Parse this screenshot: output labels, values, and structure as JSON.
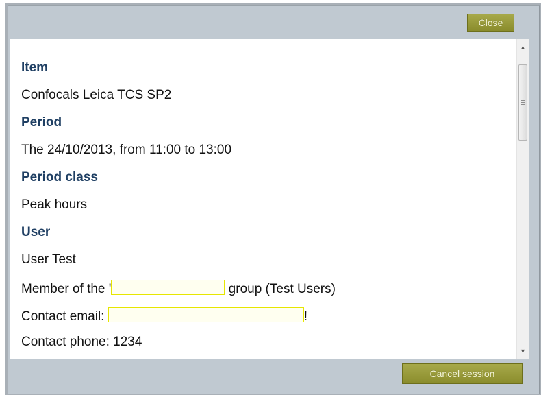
{
  "dialog": {
    "close_label": "Close",
    "cancel_label": "Cancel session"
  },
  "details": {
    "item_heading": "Item",
    "item_value": "Confocals Leica TCS SP2",
    "period_heading": "Period",
    "period_value": "The 24/10/2013, from 11:00 to 13:00",
    "period_class_heading": "Period class",
    "period_class_value": "Peak hours",
    "user_heading": "User",
    "user_name": "User Test",
    "member_prefix": "Member of the '",
    "member_suffix": " group (Test Users)",
    "email_prefix": "Contact email: ",
    "email_suffix": "!",
    "phone_line": "Contact phone: 1234"
  },
  "colors": {
    "heading": "#1f3f63",
    "button": "#9a9c3c",
    "dialog_bg": "#c0c9d1",
    "redaction_border": "#e6e600"
  },
  "icons": {
    "scroll_up": "scroll-up-arrow-icon",
    "scroll_down": "scroll-down-arrow-icon"
  }
}
